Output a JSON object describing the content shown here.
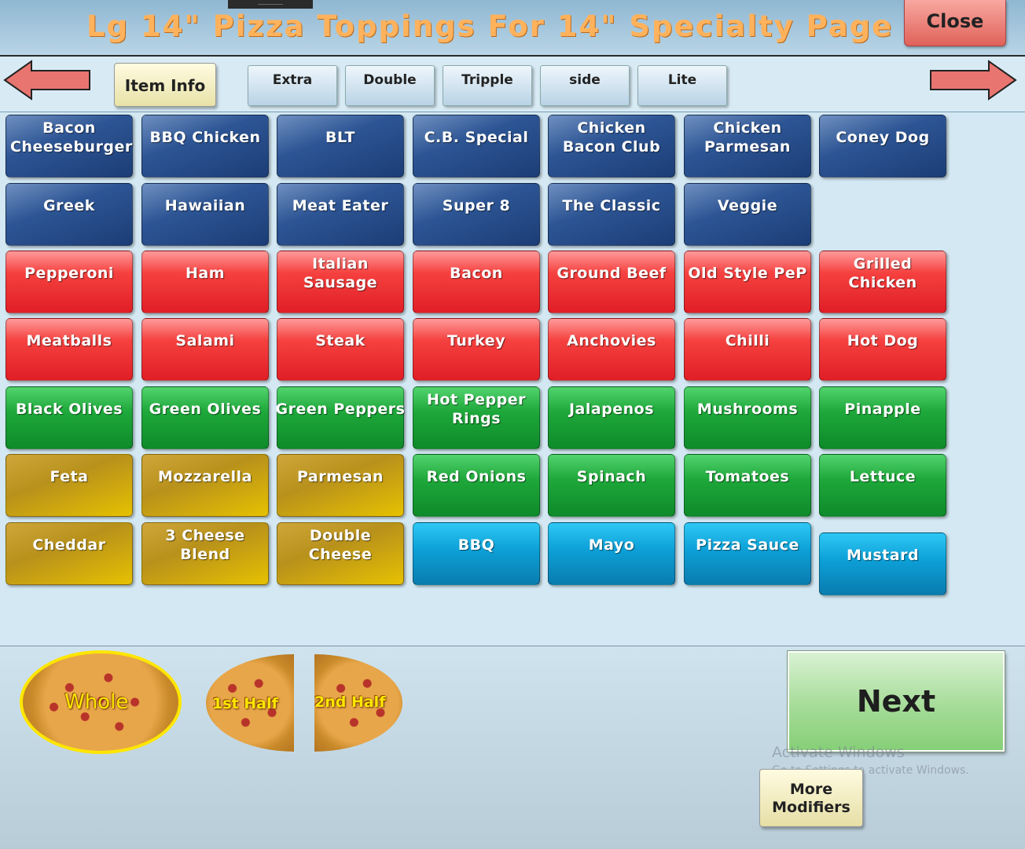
{
  "header": {
    "title": "Lg 14\" Pizza Toppings For 14\" Specialty  Page",
    "close_label": "Close"
  },
  "toolbar": {
    "item_info_label": "Item Info",
    "modifiers": [
      "Extra",
      "Double",
      "Tripple",
      "side",
      "Lite"
    ]
  },
  "toppings": {
    "r0": [
      "Bacon Cheeseburger",
      "BBQ Chicken",
      "BLT",
      "C.B. Special",
      "Chicken Bacon Club",
      "Chicken Parmesan",
      "Coney Dog"
    ],
    "r1": [
      "Greek",
      "Hawaiian",
      "Meat Eater",
      "Super 8",
      "The Classic",
      "Veggie"
    ],
    "r2": [
      "Pepperoni",
      "Ham",
      "Italian Sausage",
      "Bacon",
      "Ground Beef",
      "Old Style PeP",
      "Grilled Chicken"
    ],
    "r3": [
      "Meatballs",
      "Salami",
      "Steak",
      "Turkey",
      "Anchovies",
      "Chilli",
      "Hot Dog"
    ],
    "r4": [
      "Black Olives",
      "Green Olives",
      "Green Peppers",
      "Hot Pepper Rings",
      "Jalapenos",
      "Mushrooms",
      "Pinapple"
    ],
    "r5": [
      "Feta",
      "Mozzarella",
      "Parmesan",
      "Red Onions",
      "Spinach",
      "Tomatoes",
      "Lettuce"
    ],
    "r6": [
      "Cheddar",
      "3 Cheese Blend",
      "Double Cheese",
      "BBQ",
      "Mayo",
      "Pizza Sauce",
      "Mustard"
    ]
  },
  "placement": {
    "whole": "Whole",
    "first_half": "1st Half",
    "second_half": "2nd Half"
  },
  "actions": {
    "next_label": "Next",
    "more_modifiers_line1": "More",
    "more_modifiers_line2": "Modifiers"
  },
  "watermark": {
    "line1": "Activate Windows",
    "line2": "Go to Settings to activate Windows."
  },
  "colors": {
    "specialty": "#2d5594",
    "meat": "#e01e26",
    "veggie": "#1ea83a",
    "cheese": "#c9a214",
    "sauce": "#0c9fd6",
    "title": "#ffb25c"
  }
}
